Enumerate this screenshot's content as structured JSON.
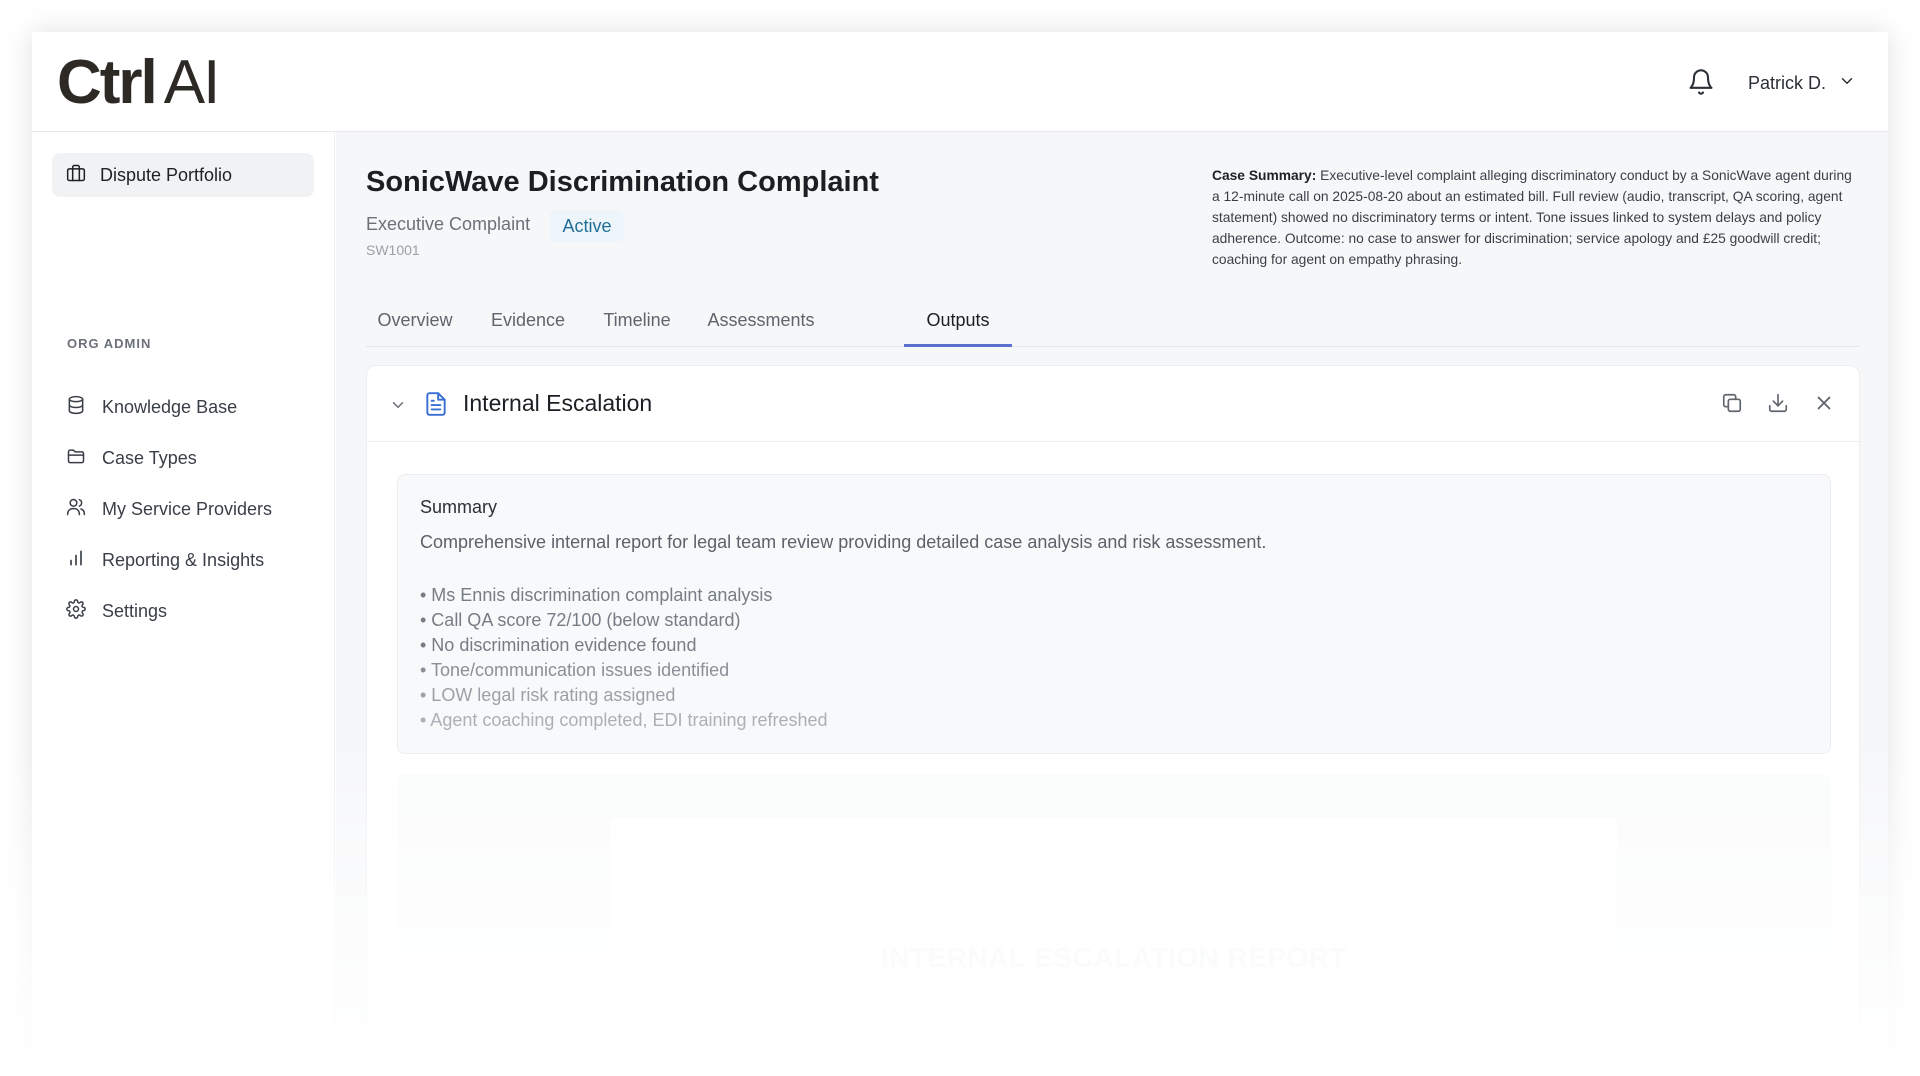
{
  "header": {
    "logo_bold": "Ctrl",
    "logo_light": "AI",
    "user_name": "Patrick D."
  },
  "sidebar": {
    "active_item": "Dispute Portfolio",
    "section_label": "ORG ADMIN",
    "items": [
      {
        "label": "Knowledge Base",
        "icon": "database-icon"
      },
      {
        "label": "Case Types",
        "icon": "folder-icon"
      },
      {
        "label": "My Service Providers",
        "icon": "users-icon"
      },
      {
        "label": "Reporting & Insights",
        "icon": "bar-chart-icon"
      },
      {
        "label": "Settings",
        "icon": "gear-icon"
      }
    ]
  },
  "case": {
    "title": "SonicWave Discrimination Complaint",
    "type": "Executive Complaint",
    "status": "Active",
    "id": "SW1001",
    "summary_label": "Case Summary:",
    "summary_text": "Executive-level complaint alleging discriminatory conduct by a SonicWave agent during a 12-minute call on 2025-08-20 about an estimated bill. Full review (audio, transcript, QA scoring, agent statement) showed no discriminatory terms or intent. Tone issues linked to system delays and policy adherence. Outcome: no case to answer for discrimination; service apology and £25 goodwill credit; coaching for agent on empathy phrasing."
  },
  "tabs": [
    {
      "label": "Overview"
    },
    {
      "label": "Evidence"
    },
    {
      "label": "Timeline"
    },
    {
      "label": "Assessments"
    },
    {
      "label": "Outputs",
      "active": true
    }
  ],
  "output": {
    "title": "Internal Escalation",
    "summary_label": "Summary",
    "summary_text": "Comprehensive internal report for legal team review providing detailed case analysis and risk assessment.",
    "bullets": [
      "• Ms Ennis discrimination complaint analysis",
      "• Call QA score 72/100 (below standard)",
      "• No discrimination evidence found",
      "• Tone/communication issues identified",
      "• LOW legal risk rating assigned",
      "• Agent coaching completed, EDI training refreshed"
    ],
    "report_title": "INTERNAL ESCALATION REPORT"
  },
  "colors": {
    "accent": "#5b6fd0",
    "badge_text": "#1f6f96",
    "badge_bg": "#eef5fa",
    "doc_icon": "#3b6fd4"
  }
}
